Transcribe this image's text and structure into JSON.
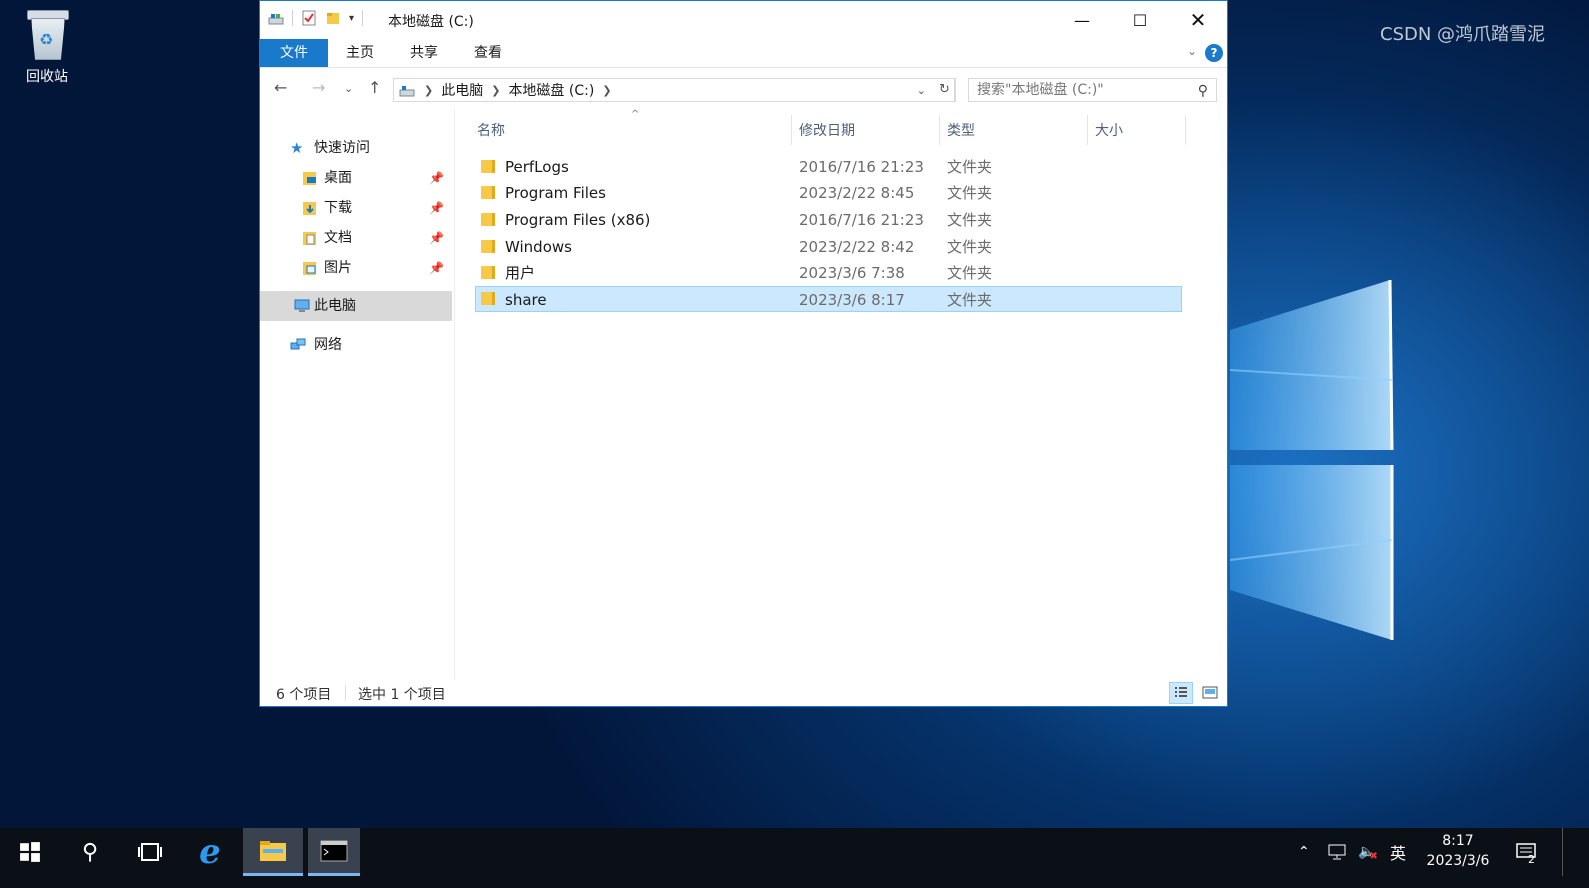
{
  "desktop": {
    "recycle_bin_label": "回收站"
  },
  "window": {
    "title": "本地磁盘 (C:)",
    "ribbon_tabs": [
      "文件",
      "主页",
      "共享",
      "查看"
    ],
    "address": {
      "crumbs": [
        "此电脑",
        "本地磁盘 (C:)"
      ]
    },
    "search_placeholder": "搜索\"本地磁盘 (C:)\"",
    "nav": {
      "quick_access": "快速访问",
      "items": [
        "桌面",
        "下载",
        "文档",
        "图片"
      ],
      "this_pc": "此电脑",
      "network": "网络"
    },
    "columns": [
      "名称",
      "修改日期",
      "类型",
      "大小"
    ],
    "files": [
      {
        "name": "PerfLogs",
        "date": "2016/7/16 21:23",
        "type": "文件夹"
      },
      {
        "name": "Program Files",
        "date": "2023/2/22 8:45",
        "type": "文件夹"
      },
      {
        "name": "Program Files (x86)",
        "date": "2016/7/16 21:23",
        "type": "文件夹"
      },
      {
        "name": "Windows",
        "date": "2023/2/22 8:42",
        "type": "文件夹"
      },
      {
        "name": "用户",
        "date": "2023/3/6 7:38",
        "type": "文件夹"
      },
      {
        "name": "share",
        "date": "2023/3/6 8:17",
        "type": "文件夹"
      }
    ],
    "status": {
      "count": "6 个项目",
      "selected": "选中 1 个项目"
    }
  },
  "taskbar": {
    "ime": "英",
    "time": "8:17",
    "date": "2023/3/6",
    "notification_count": "2"
  },
  "watermark": "CSDN @鸿爪踏雪泥",
  "colors": {
    "accent": "#1979ca",
    "selection": "#cce8ff",
    "folder": "#f7c948"
  }
}
